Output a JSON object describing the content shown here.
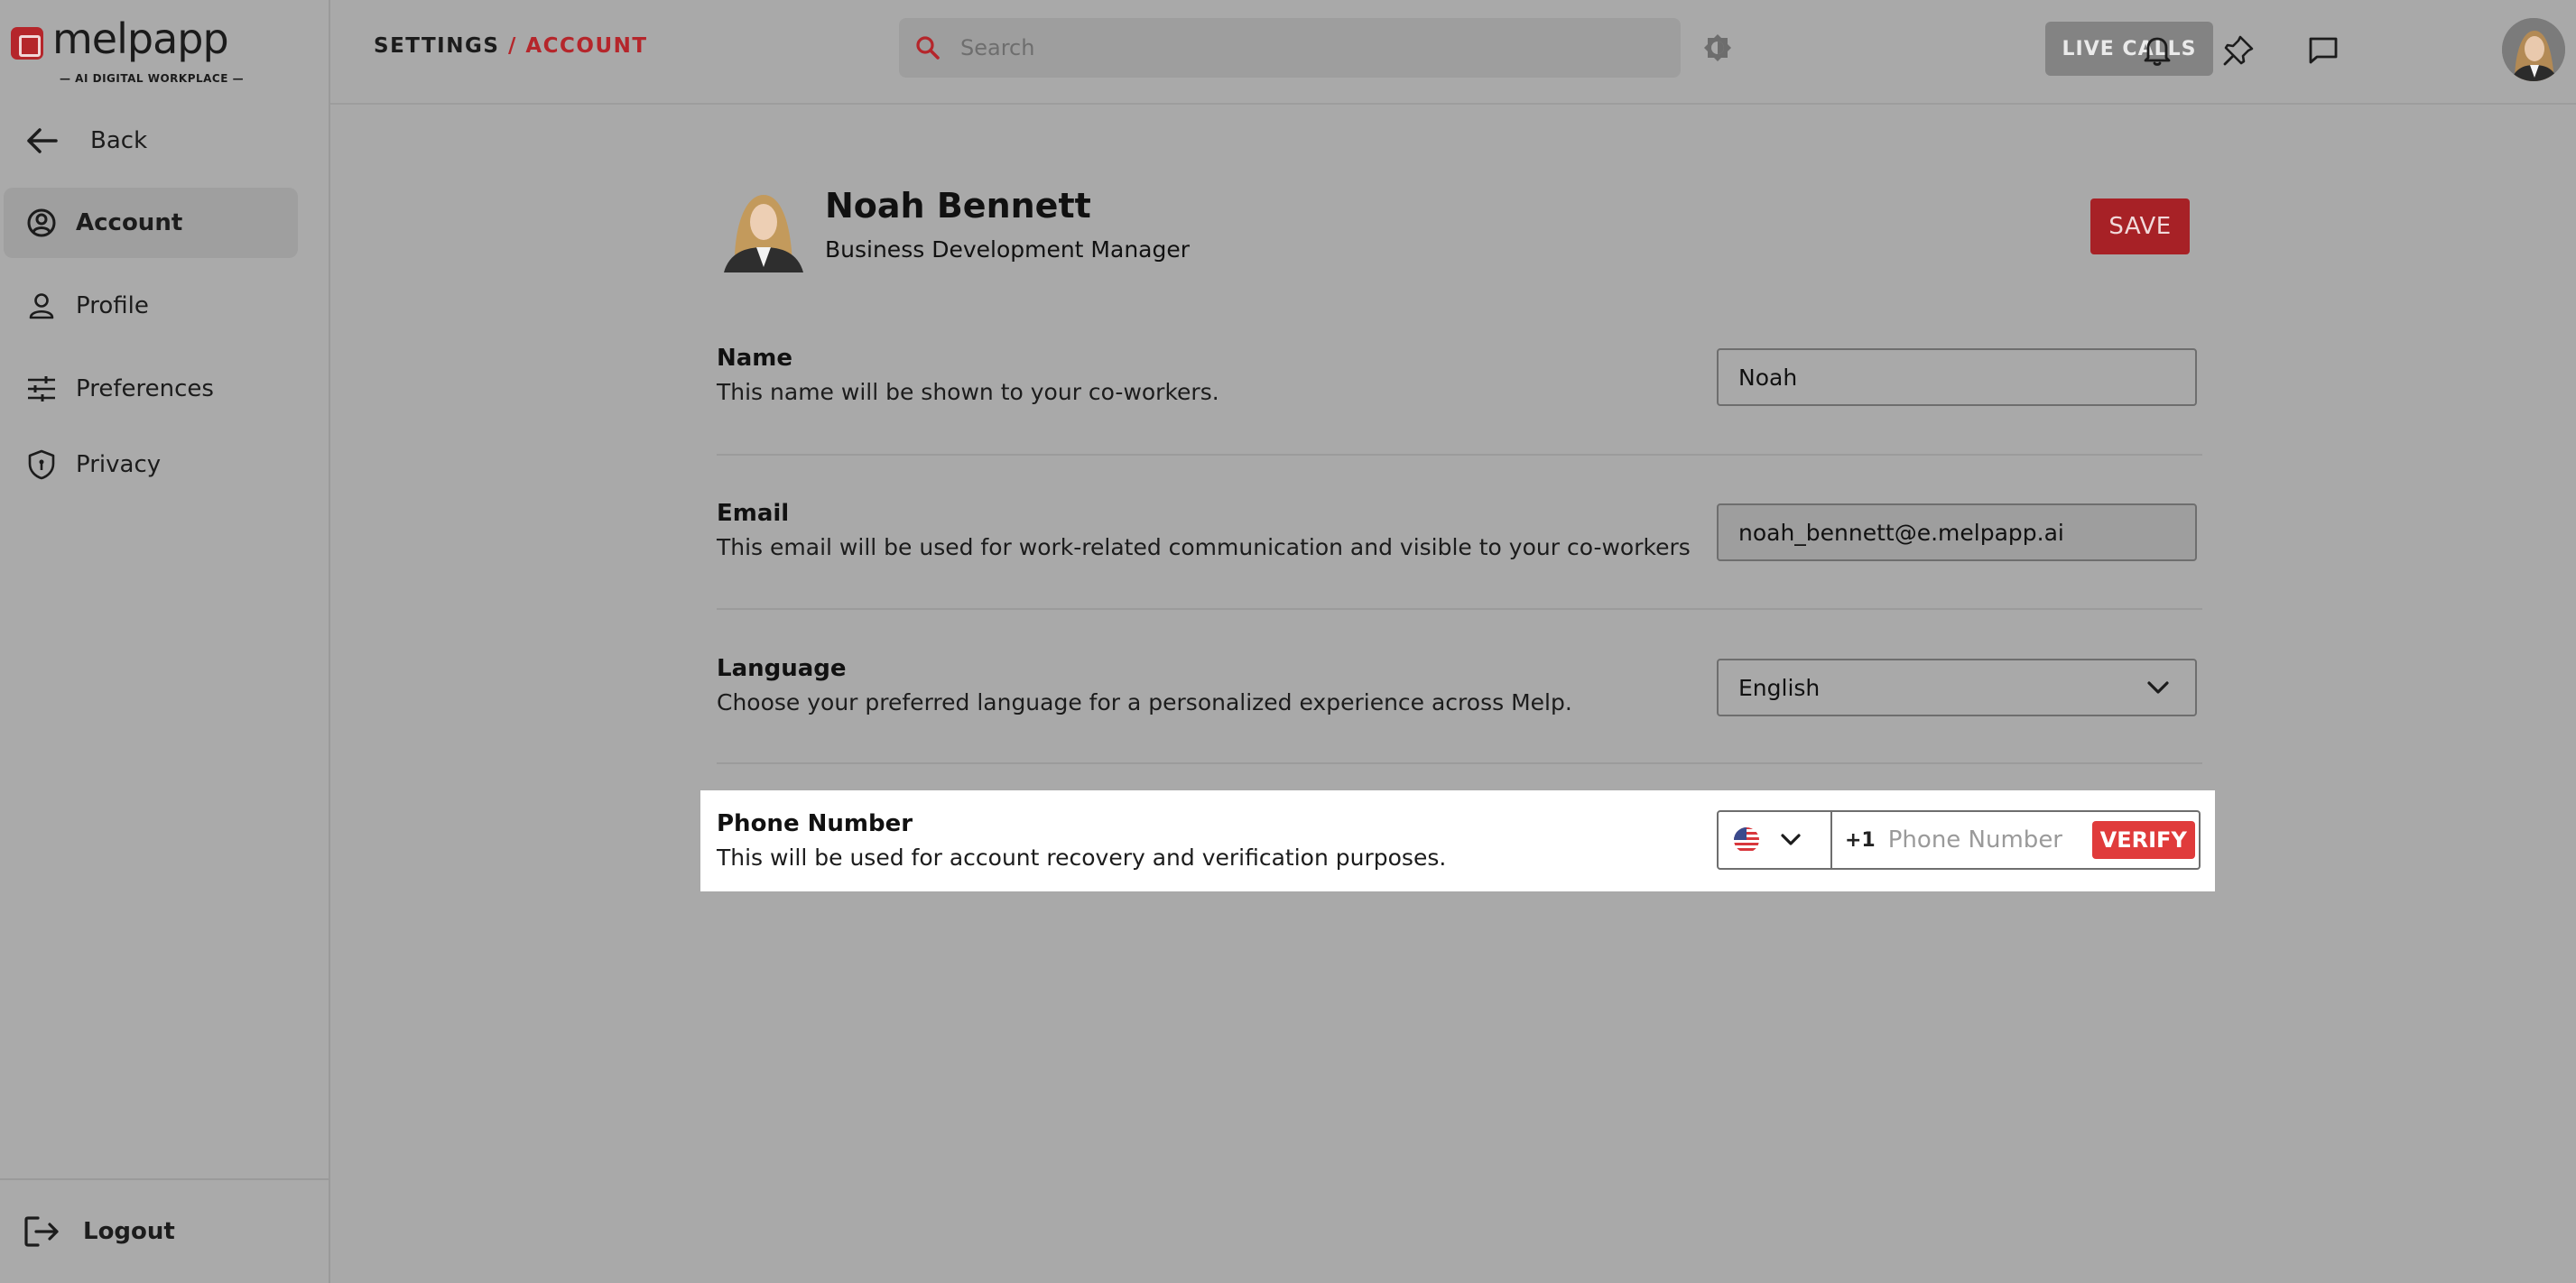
{
  "brand": {
    "name": "melpapp",
    "tagline": "— AI DIGITAL WORKPLACE —",
    "accent": "#b5262b"
  },
  "sidebar": {
    "back_label": "Back",
    "items": [
      {
        "label": "Account",
        "icon": "account-circle-icon",
        "active": true
      },
      {
        "label": "Profile",
        "icon": "person-icon",
        "active": false
      },
      {
        "label": "Preferences",
        "icon": "sliders-icon",
        "active": false
      },
      {
        "label": "Privacy",
        "icon": "shield-icon",
        "active": false
      }
    ],
    "logout_label": "Logout"
  },
  "header": {
    "breadcrumb_root": "SETTINGS",
    "breadcrumb_sep": "/",
    "breadcrumb_current": "ACCOUNT",
    "search_placeholder": "Search",
    "live_calls_label": "LIVE CALLS"
  },
  "profile": {
    "name": "Noah Bennett",
    "title": "Business Development Manager",
    "save_label": "SAVE"
  },
  "fields": {
    "name": {
      "label": "Name",
      "description": "This name will be shown to your co-workers.",
      "value": "Noah"
    },
    "email": {
      "label": "Email",
      "description": "This email will be used for work-related communication and visible to your co-workers",
      "value": "noah_bennett@e.melpapp.ai"
    },
    "language": {
      "label": "Language",
      "description": "Choose your preferred language for a personalized experience across Melp.",
      "value": "English"
    },
    "phone": {
      "label": "Phone Number",
      "description": "This will be used for account recovery and verification purposes.",
      "country_flag": "us-flag-icon",
      "dial_code": "+1",
      "placeholder": "Phone Number",
      "verify_label": "VERIFY"
    }
  }
}
